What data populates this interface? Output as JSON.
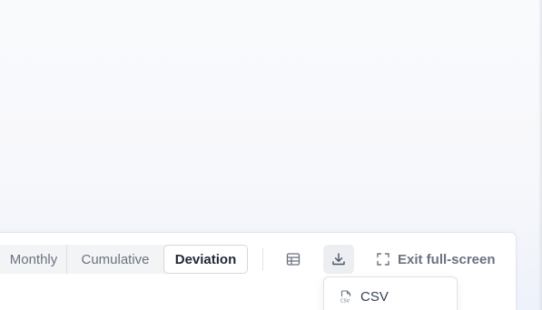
{
  "toolbar": {
    "segments": [
      {
        "label": "Monthly"
      },
      {
        "label": "Cumulative"
      },
      {
        "label": "Deviation",
        "selected": true
      }
    ],
    "table_icon": "table-icon",
    "download_icon": "download-icon",
    "exit_fullscreen": {
      "label": "Exit full-screen",
      "icon": "exit-fullscreen-icon"
    }
  },
  "download_menu": {
    "items": [
      {
        "label": "CSV",
        "icon": "csv-file-icon"
      }
    ]
  },
  "colors": {
    "text_muted": "#6b7280",
    "text_active": "#1f2937",
    "panel_bg": "#ffffff",
    "page_bg": "#f8f9fb"
  }
}
